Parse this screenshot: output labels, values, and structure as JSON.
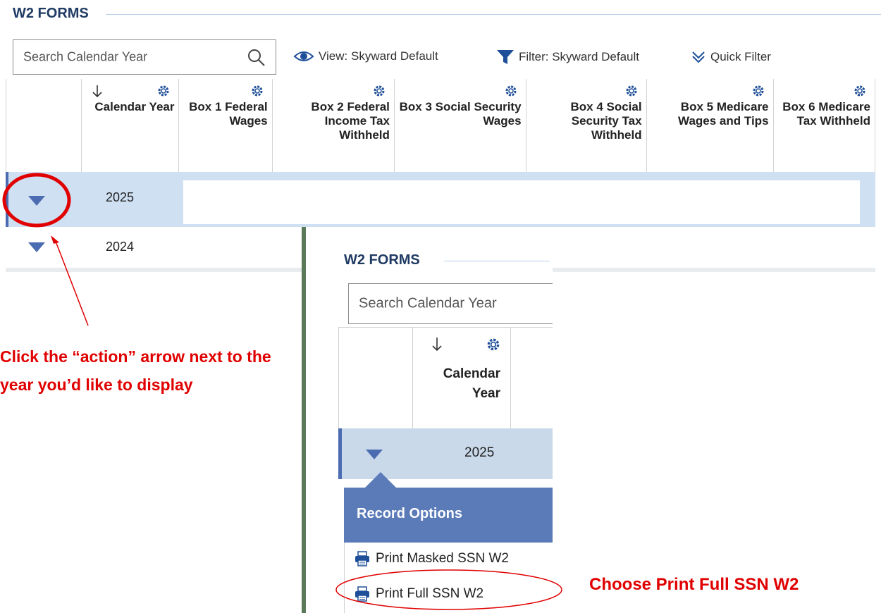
{
  "main": {
    "section_title": "W2 FORMS",
    "search_placeholder": "Search Calendar Year",
    "toolbar": {
      "view_label": "View: Skyward Default",
      "filter_label": "Filter: Skyward Default",
      "quick_filter_label": "Quick Filter"
    },
    "columns": [
      {
        "label": "Calendar Year"
      },
      {
        "label": "Box 1 Federal Wages"
      },
      {
        "label": "Box 2 Federal Income Tax Withheld"
      },
      {
        "label": "Box 3 Social Security Wages"
      },
      {
        "label": "Box 4 Social Security Tax Withheld"
      },
      {
        "label": "Box 5 Medicare Wages and Tips"
      },
      {
        "label": "Box 6 Medicare Tax Withheld"
      }
    ],
    "rows": [
      {
        "year": "2025"
      },
      {
        "year": "2024"
      }
    ]
  },
  "inset": {
    "section_title": "W2 FORMS",
    "search_placeholder": "Search Calendar Year",
    "column_label": "Calendar Year",
    "row_year": "2025",
    "menu_title": "Record Options",
    "menu_items": [
      "Print Masked SSN W2",
      "Print Full SSN W2"
    ]
  },
  "annotations": {
    "left_note": "Click the “action” arrow next to the year you’d like to display",
    "right_note": "Choose Print Full SSN W2"
  },
  "colors": {
    "accent_blue": "#4b6cb0",
    "menu_header": "#5a7ab8",
    "selected_row": "#cfe0f3",
    "annotation_red": "#e00000"
  }
}
